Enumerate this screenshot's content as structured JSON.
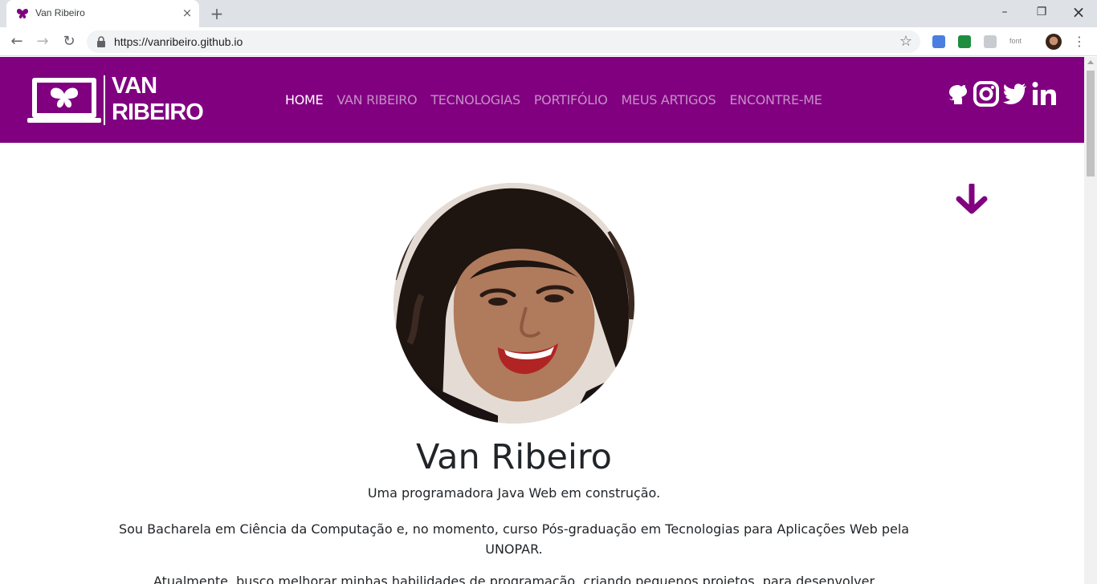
{
  "browser": {
    "tab_title": "Van Ribeiro",
    "tab_close": "×",
    "new_tab": "+",
    "url": "https://vanribeiro.github.io",
    "ext_font_label": "font",
    "window": {
      "minimize": "–",
      "restore": "❐",
      "close": "×"
    },
    "nav": {
      "back": "←",
      "forward": "→",
      "reload": "↻",
      "bookmark": "☆",
      "menu": "⋮"
    }
  },
  "header": {
    "logo_line1": "VAN",
    "logo_line2": "RIBEIRO",
    "nav_items": [
      {
        "label": "HOME",
        "active": true
      },
      {
        "label": "VAN RIBEIRO",
        "active": false
      },
      {
        "label": "TECNOLOGIAS",
        "active": false
      },
      {
        "label": "PORTIFÓLIO",
        "active": false
      },
      {
        "label": "MEUS ARTIGOS",
        "active": false
      },
      {
        "label": "ENCONTRE-ME",
        "active": false
      }
    ],
    "social_icons": [
      "github-icon",
      "instagram-icon",
      "twitter-icon",
      "linkedin-icon"
    ]
  },
  "main": {
    "name": "Van Ribeiro",
    "tagline": "Uma programadora Java Web em construção.",
    "bio1": "Sou Bacharela em Ciência da Computação e, no momento, curso Pós-graduação em Tecnologias para Aplicações Web pela UNOPAR.",
    "bio2": "Atualmente, busco melhorar minhas habilidades de programação, criando pequenos projetos, para desenvolver"
  },
  "colors": {
    "brand": "#800080",
    "text": "#212529"
  }
}
